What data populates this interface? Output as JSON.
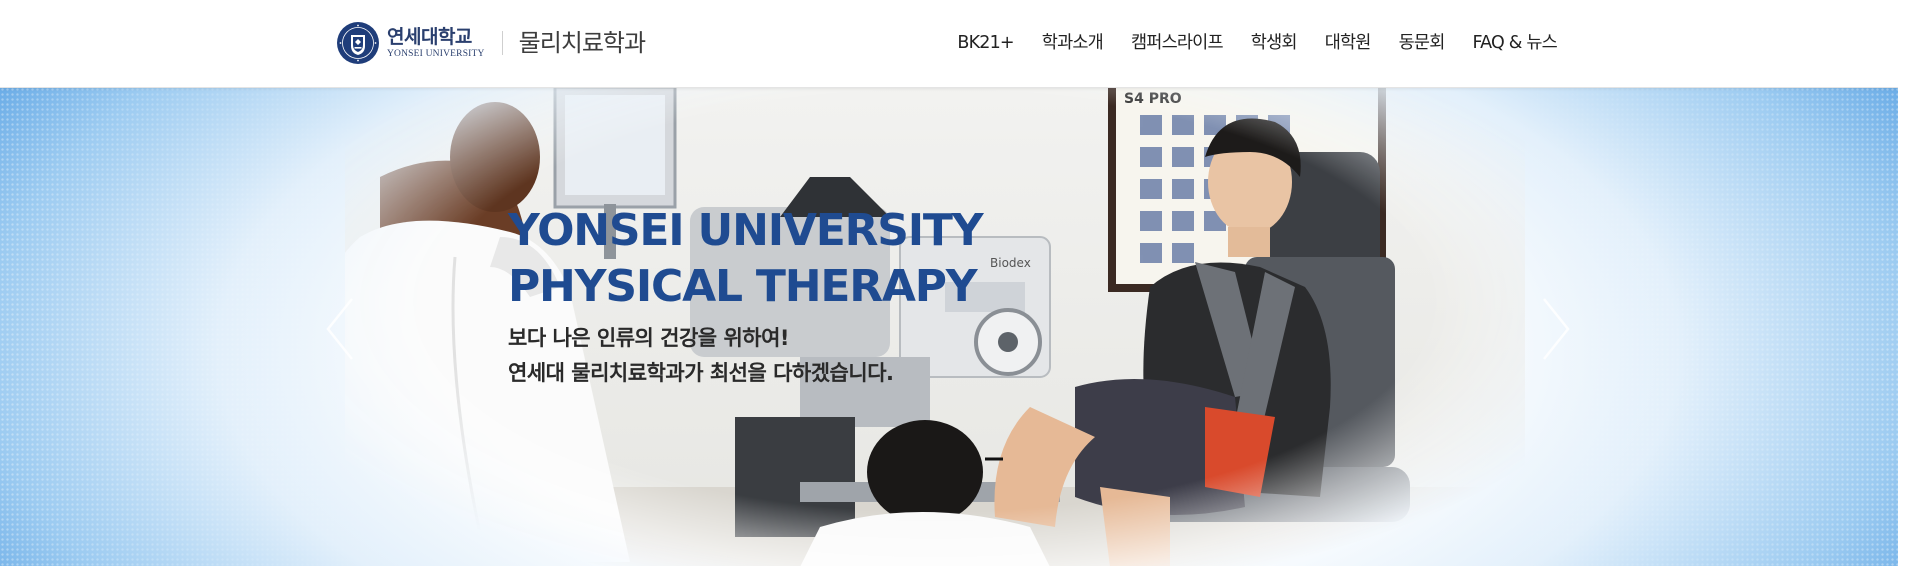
{
  "header": {
    "university_ko": "연세대학교",
    "university_en": "YONSEI UNIVERSITY",
    "department": "물리치료학과",
    "logo_icon": "university-seal-icon",
    "brand_color": "#2a3f6e"
  },
  "nav": {
    "items": [
      {
        "label": "BK21+"
      },
      {
        "label": "학과소개"
      },
      {
        "label": "캠퍼스라이프"
      },
      {
        "label": "학생회"
      },
      {
        "label": "대학원"
      },
      {
        "label": "동문회"
      },
      {
        "label": "FAQ & 뉴스"
      }
    ]
  },
  "hero": {
    "title_line1": "YONSEI UNIVERSITY",
    "title_line2": "PHYSICAL THERAPY",
    "subtitle_line1": "보다 나은 인류의 건강을 위하여!",
    "subtitle_line2": "연세대 물리치료학과가 최선을 다하겠습니다.",
    "title_color": "#1f4b91",
    "background_color": "#4a98e0",
    "prev_icon": "chevron-left-icon",
    "next_icon": "chevron-right-icon",
    "photo_device_label": "Biodex",
    "poster_label": "S4 PRO"
  }
}
